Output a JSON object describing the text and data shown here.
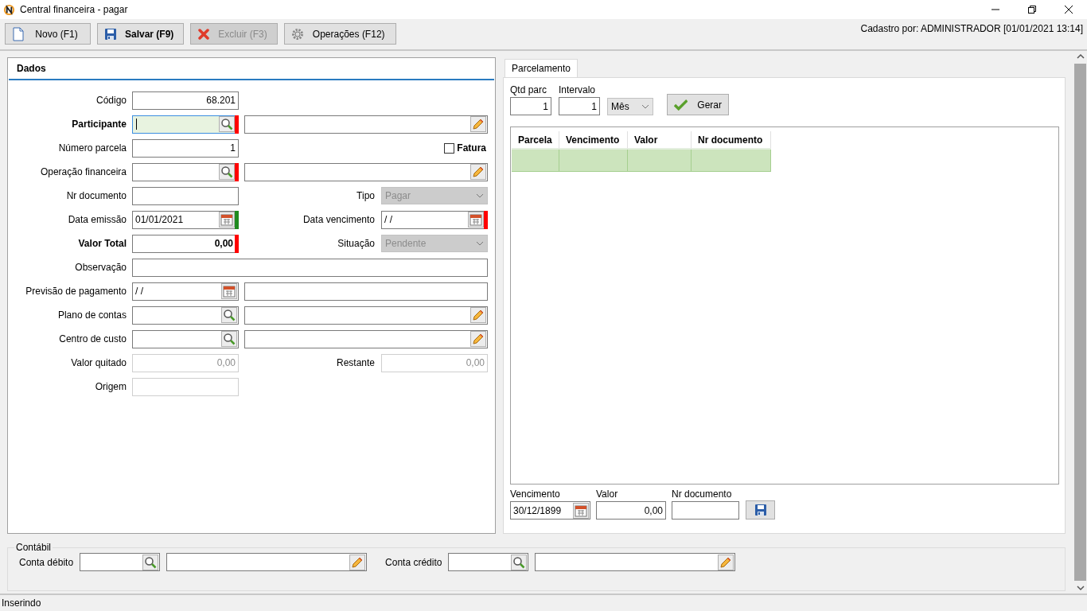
{
  "window": {
    "title": "Central financeira - pagar"
  },
  "toolbar": [
    {
      "kind": "new",
      "label": "Novo (F1)",
      "bold": false,
      "disabled": false
    },
    {
      "kind": "save",
      "label": "Salvar (F9)",
      "bold": true,
      "disabled": false
    },
    {
      "kind": "delete",
      "label": "Excluir (F3)",
      "bold": false,
      "disabled": true
    },
    {
      "kind": "operations",
      "label": "Operações (F12)",
      "bold": false,
      "disabled": false
    }
  ],
  "record_info": "Cadastro por: ADMINISTRADOR [01/01/2021 13:14]",
  "dados": {
    "title": "Dados",
    "rows": [
      {
        "label": "Código",
        "bold": false,
        "field": {
          "kind": "number",
          "value": "68.201"
        }
      },
      {
        "label": "Participante",
        "bold": true,
        "field": {
          "kind": "lookup",
          "focused": true,
          "color": "#ff0000"
        },
        "right": {
          "kind": "edit"
        }
      },
      {
        "label": "Número parcela",
        "bold": false,
        "field": {
          "kind": "number",
          "value": "1"
        },
        "right": {
          "kind": "checkbox",
          "label": "Fatura",
          "checked": false
        }
      },
      {
        "label": "Operação financeira",
        "bold": false,
        "field": {
          "kind": "lookup",
          "color": "#ff0000"
        },
        "right": {
          "kind": "edit"
        }
      },
      {
        "label": "Nr documento",
        "bold": false,
        "field": {
          "kind": "text"
        },
        "right": {
          "kind": "select",
          "label": "Tipo",
          "value": "Pagar",
          "disabled": true
        }
      },
      {
        "label": "Data emissão",
        "bold": false,
        "field": {
          "kind": "date",
          "value": "01/01/2021",
          "color": "#1f8a1f"
        },
        "right": {
          "kind": "date",
          "label": "Data vencimento",
          "value": "/ /",
          "color": "#ff0000"
        }
      },
      {
        "label": "Valor Total",
        "bold": true,
        "field": {
          "kind": "number",
          "value": "0,00",
          "color": "#ff0000"
        },
        "right": {
          "kind": "select",
          "label": "Situação",
          "value": "Pendente",
          "disabled": true
        }
      },
      {
        "label": "Observação",
        "bold": false,
        "field": {
          "kind": "wide"
        }
      },
      {
        "label": "Previsão de pagamento",
        "bold": false,
        "field": {
          "kind": "date",
          "value": "/ /"
        },
        "right": {
          "kind": "plain"
        }
      },
      {
        "label": "Plano de contas",
        "bold": false,
        "field": {
          "kind": "lookup"
        },
        "right": {
          "kind": "edit"
        }
      },
      {
        "label": "Centro de custo",
        "bold": false,
        "field": {
          "kind": "lookup"
        },
        "right": {
          "kind": "edit"
        }
      },
      {
        "label": "Valor quitado",
        "bold": false,
        "field": {
          "kind": "number",
          "value": "0,00",
          "disabled": true
        },
        "right": {
          "kind": "text",
          "label": "Restante",
          "value": "0,00",
          "disabled": true
        }
      },
      {
        "label": "Origem",
        "bold": false,
        "field": {
          "kind": "text",
          "disabled": true
        }
      }
    ]
  },
  "parcelamento": {
    "tabs": [
      {
        "label": "Parcelamento",
        "selected": true
      }
    ],
    "qtd_parc": {
      "label": "Qtd parc",
      "value": "1"
    },
    "intervalo": {
      "label": "Intervalo",
      "value": "1"
    },
    "unidade": {
      "value": "Mês"
    },
    "gerar_button": "Gerar",
    "table": {
      "columns": [
        "Parcela",
        "Vencimento",
        "Valor",
        "Nr documento"
      ],
      "rows": [
        {
          "cells": [],
          "selected": true
        }
      ]
    },
    "vencimento": {
      "label": "Vencimento",
      "value": "30/12/1899"
    },
    "valor": {
      "label": "Valor",
      "value": "0,00"
    },
    "nr_documento": {
      "label": "Nr documento"
    }
  },
  "contabil": {
    "title": "Contábil",
    "fields": [
      {
        "label": "Conta débito"
      },
      {
        "label": "Conta crédito"
      }
    ]
  },
  "status_bar": "Inserindo"
}
